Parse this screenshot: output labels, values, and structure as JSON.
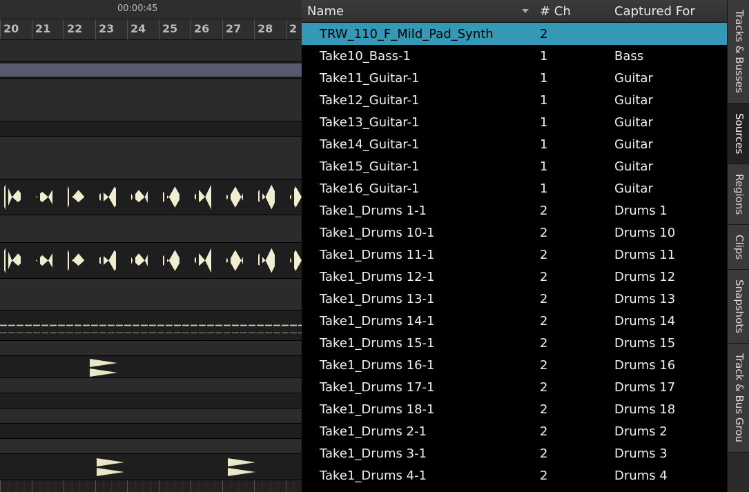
{
  "ruler": {
    "timecode": "00:00:45",
    "bars": [
      "20",
      "21",
      "22",
      "23",
      "24",
      "25",
      "26",
      "27",
      "28",
      "2"
    ]
  },
  "list": {
    "columns": {
      "name": "Name",
      "channels": "# Ch",
      "captured_for": "Captured For"
    },
    "sort_column": "name",
    "rows": [
      {
        "name": "TRW_110_F_Mild_Pad_Synth",
        "ch": "2",
        "cap": "",
        "selected": true
      },
      {
        "name": "Take10_Bass-1",
        "ch": "1",
        "cap": "Bass",
        "selected": false
      },
      {
        "name": "Take11_Guitar-1",
        "ch": "1",
        "cap": "Guitar",
        "selected": false
      },
      {
        "name": "Take12_Guitar-1",
        "ch": "1",
        "cap": "Guitar",
        "selected": false
      },
      {
        "name": "Take13_Guitar-1",
        "ch": "1",
        "cap": "Guitar",
        "selected": false
      },
      {
        "name": "Take14_Guitar-1",
        "ch": "1",
        "cap": "Guitar",
        "selected": false
      },
      {
        "name": "Take15_Guitar-1",
        "ch": "1",
        "cap": "Guitar",
        "selected": false
      },
      {
        "name": "Take16_Guitar-1",
        "ch": "1",
        "cap": "Guitar",
        "selected": false
      },
      {
        "name": "Take1_Drums 1-1",
        "ch": "2",
        "cap": "Drums 1",
        "selected": false
      },
      {
        "name": "Take1_Drums 10-1",
        "ch": "2",
        "cap": "Drums 10",
        "selected": false
      },
      {
        "name": "Take1_Drums 11-1",
        "ch": "2",
        "cap": "Drums 11",
        "selected": false
      },
      {
        "name": "Take1_Drums 12-1",
        "ch": "2",
        "cap": "Drums 12",
        "selected": false
      },
      {
        "name": "Take1_Drums 13-1",
        "ch": "2",
        "cap": "Drums 13",
        "selected": false
      },
      {
        "name": "Take1_Drums 14-1",
        "ch": "2",
        "cap": "Drums 14",
        "selected": false
      },
      {
        "name": "Take1_Drums 15-1",
        "ch": "2",
        "cap": "Drums 15",
        "selected": false
      },
      {
        "name": "Take1_Drums 16-1",
        "ch": "2",
        "cap": "Drums 16",
        "selected": false
      },
      {
        "name": "Take1_Drums 17-1",
        "ch": "2",
        "cap": "Drums 17",
        "selected": false
      },
      {
        "name": "Take1_Drums 18-1",
        "ch": "2",
        "cap": "Drums 18",
        "selected": false
      },
      {
        "name": "Take1_Drums 2-1",
        "ch": "2",
        "cap": "Drums 2",
        "selected": false
      },
      {
        "name": "Take1_Drums 3-1",
        "ch": "2",
        "cap": "Drums 3",
        "selected": false
      },
      {
        "name": "Take1_Drums 4-1",
        "ch": "2",
        "cap": "Drums 4",
        "selected": false
      }
    ]
  },
  "vtabs": [
    {
      "label": "Tracks & Busses",
      "active": false
    },
    {
      "label": "Sources",
      "active": true
    },
    {
      "label": "Regions",
      "active": false
    },
    {
      "label": "Clips",
      "active": false
    },
    {
      "label": "Snapshots",
      "active": false
    },
    {
      "label": "Track & Bus Grou",
      "active": false
    }
  ]
}
